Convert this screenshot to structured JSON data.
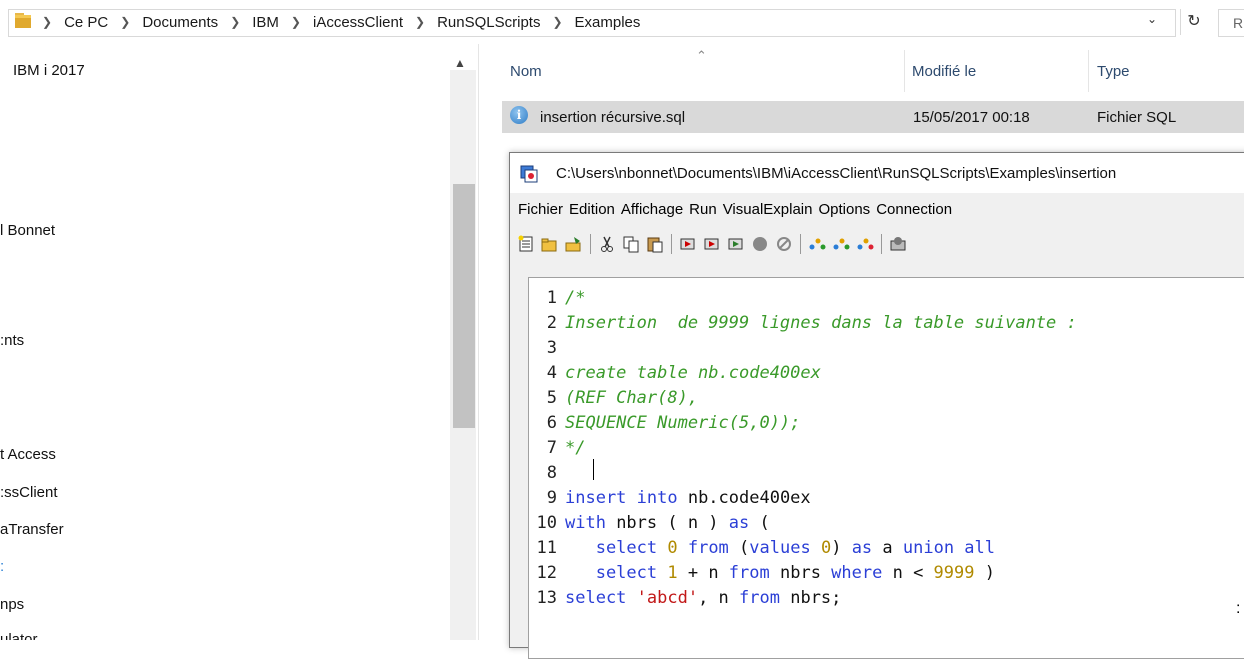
{
  "address_bar": {
    "breadcrumbs": [
      "Ce PC",
      "Documents",
      "IBM",
      "iAccessClient",
      "RunSQLScripts",
      "Examples"
    ],
    "search_placeholder": "R"
  },
  "nav_pane": {
    "items": [
      "IBM i 2017",
      "l Bonnet",
      ":nts",
      "t Access",
      ":ssClient",
      "aTransfer",
      ":",
      "nps",
      "ulator"
    ]
  },
  "file_list": {
    "columns": [
      "Nom",
      "Modifié le",
      "Type"
    ],
    "rows": [
      {
        "name": "insertion récursive.sql",
        "modified": "15/05/2017 00:18",
        "type": "Fichier SQL"
      }
    ]
  },
  "sql_window": {
    "title": "C:\\Users\\nbonnet\\Documents\\IBM\\iAccessClient\\RunSQLScripts\\Examples\\insertion",
    "menu": [
      "Fichier",
      "Edition",
      "Affichage",
      "Run",
      "VisualExplain",
      "Options",
      "Connection"
    ],
    "toolbar_icons": [
      "new-script-icon",
      "open-icon",
      "save-icon",
      "cut-icon",
      "copy-icon",
      "paste-icon",
      "run-all-icon",
      "run-from-selected-icon",
      "run-selected-icon",
      "stop-icon",
      "cancel-icon",
      "explain-icon",
      "explain-selected-icon",
      "visual-explain-icon",
      "connection-icon"
    ],
    "line_numbers": [
      "1",
      "2",
      "3",
      "4",
      "5",
      "6",
      "7",
      "8",
      "9",
      "10",
      "11",
      "12",
      "13"
    ],
    "code": {
      "l1": "/*",
      "l2": "Insertion  de 9999 lignes dans la table suivante :",
      "l4": "create table nb.code400ex",
      "l5": "(REF Char(8),",
      "l6": "SEQUENCE Numeric(5,0));",
      "l7": "*/",
      "l9a": "insert into",
      "l9b": " nb.code400ex",
      "l10a": "with",
      "l10b": " nbrs ( n ) ",
      "l10c": "as",
      "l10d": " (",
      "l11a": "   select ",
      "l11b": "0",
      "l11c": " from",
      "l11d": " (",
      "l11e": "values",
      "l11f": " ",
      "l11g": "0",
      "l11h": ") ",
      "l11i": "as",
      "l11j": " a ",
      "l11k": "union all",
      "l12a": "   select ",
      "l12b": "1",
      "l12c": " + n ",
      "l12d": "from",
      "l12e": " nbrs ",
      "l12f": "where",
      "l12g": " n < ",
      "l12h": "9999",
      "l12i": " )",
      "l13a": "select ",
      "l13b": "'abcd'",
      "l13c": ", n ",
      "l13d": "from",
      "l13e": " nbrs;"
    }
  },
  "side_glyph": ":"
}
